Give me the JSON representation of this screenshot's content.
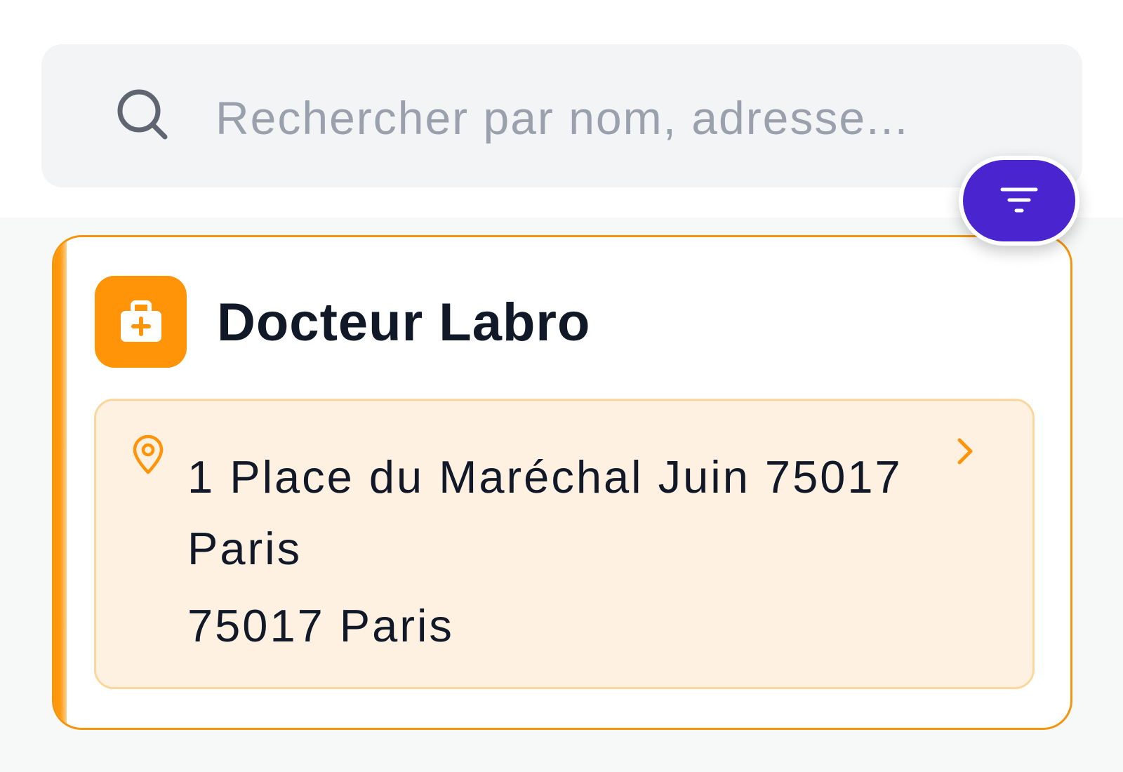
{
  "search": {
    "placeholder": "Rechercher par nom, adresse...",
    "value": "",
    "icon": "search-icon"
  },
  "filter": {
    "icon": "filter-icon",
    "color": "#4A25CF"
  },
  "results": [
    {
      "name": "Docteur Labro",
      "icon": "medical-kit-icon",
      "accent_color": "#FF9408",
      "address": {
        "street": "1 Place du Maréchal Juin 75017 Paris",
        "city": "75017 Paris",
        "pin_icon": "map-pin-icon",
        "chevron_icon": "chevron-right-icon"
      }
    }
  ]
}
